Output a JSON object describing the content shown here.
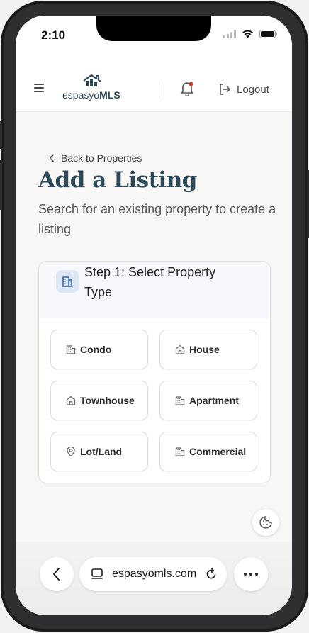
{
  "status_bar": {
    "time": "2:10",
    "icons": [
      "signal-icon",
      "wifi-icon",
      "battery-icon"
    ]
  },
  "header": {
    "logo_text_light": "espasyo",
    "logo_text_bold": "MLS",
    "logout_label": "Logout"
  },
  "main": {
    "back_label": "Back to Properties",
    "title": "Add a Listing",
    "subtitle": "Search for an existing property to create a listing",
    "step_title": "Step 1: Select Property Type",
    "property_types": [
      {
        "label": "Condo",
        "icon": "building-icon"
      },
      {
        "label": "House",
        "icon": "house-icon"
      },
      {
        "label": "Townhouse",
        "icon": "house-icon"
      },
      {
        "label": "Apartment",
        "icon": "building-icon"
      },
      {
        "label": "Lot/Land",
        "icon": "map-pin-icon"
      },
      {
        "label": "Commercial",
        "icon": "building-icon"
      }
    ]
  },
  "browser": {
    "url": "espasyomls.com"
  },
  "colors": {
    "brand": "#2d4a5a",
    "accent_dot": "#c0392b",
    "step_icon_bg": "#dde7f5",
    "step_icon": "#2f5fa8"
  }
}
